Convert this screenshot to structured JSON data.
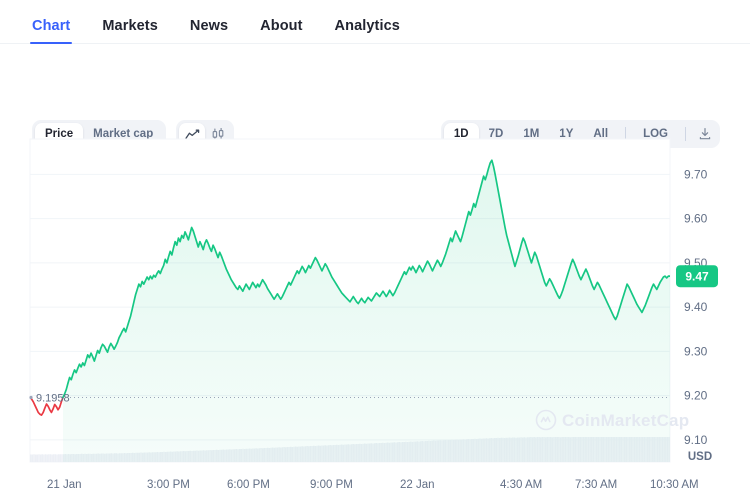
{
  "tabs": [
    {
      "label": "Chart",
      "active": true
    },
    {
      "label": "Markets",
      "active": false
    },
    {
      "label": "News",
      "active": false
    },
    {
      "label": "About",
      "active": false
    },
    {
      "label": "Analytics",
      "active": false
    }
  ],
  "toolbar": {
    "metric_toggle": [
      {
        "label": "Price",
        "active": true
      },
      {
        "label": "Market cap",
        "active": false
      }
    ],
    "chart_type_toggle": [
      {
        "icon": "line-chart-icon",
        "active": true
      },
      {
        "icon": "candlestick-chart-icon",
        "active": false
      }
    ],
    "ranges": [
      {
        "label": "1D",
        "active": true
      },
      {
        "label": "7D",
        "active": false
      },
      {
        "label": "1M",
        "active": false
      },
      {
        "label": "1Y",
        "active": false
      },
      {
        "label": "All",
        "active": false
      }
    ],
    "log_label": "LOG",
    "download_icon": "download-icon"
  },
  "chart_data": {
    "type": "line",
    "title": "",
    "xlabel": "",
    "ylabel": "USD",
    "currency_label": "USD",
    "ylim": [
      9.05,
      9.78
    ],
    "yticks": [
      9.7,
      9.6,
      9.5,
      9.4,
      9.3,
      9.2,
      9.1
    ],
    "ytick_labels": [
      "9.70",
      "9.60",
      "9.50",
      "9.40",
      "9.30",
      "9.20",
      "9.10"
    ],
    "xtick_labels": [
      "21 Jan",
      "3:00 PM",
      "6:00 PM",
      "9:00 PM",
      "22 Jan",
      "4:30 AM",
      "7:30 AM",
      "10:30 AM"
    ],
    "grid": true,
    "legend": "none",
    "current_price_badge": "9.47",
    "current_price": 9.47,
    "reference_line_value": 9.1958,
    "reference_line_label": "9.1958",
    "open_price": 9.1958,
    "high_price": 9.73,
    "low_price": 9.155,
    "line_color_up": "#16c784",
    "line_color_down": "#ea3943",
    "area_fill_color": "#e9f8f1",
    "badge_color": "#16c784",
    "watermark": "CoinMarketCap",
    "watermark_icon": "coinmarketcap-logo-icon",
    "series": [
      {
        "name": "Price",
        "values": [
          9.196,
          9.192,
          9.186,
          9.178,
          9.17,
          9.162,
          9.158,
          9.156,
          9.162,
          9.172,
          9.181,
          9.176,
          9.168,
          9.162,
          9.17,
          9.18,
          9.175,
          9.168,
          9.174,
          9.186,
          9.196,
          9.204,
          9.214,
          9.228,
          9.241,
          9.236,
          9.248,
          9.258,
          9.252,
          9.262,
          9.271,
          9.265,
          9.274,
          9.268,
          9.28,
          9.292,
          9.286,
          9.296,
          9.288,
          9.278,
          9.29,
          9.302,
          9.296,
          9.308,
          9.316,
          9.312,
          9.305,
          9.298,
          9.31,
          9.318,
          9.312,
          9.305,
          9.312,
          9.32,
          9.331,
          9.338,
          9.346,
          9.352,
          9.344,
          9.356,
          9.368,
          9.38,
          9.396,
          9.412,
          9.428,
          9.44,
          9.452,
          9.446,
          9.458,
          9.452,
          9.46,
          9.468,
          9.462,
          9.47,
          9.464,
          9.472,
          9.468,
          9.476,
          9.482,
          9.476,
          9.486,
          9.494,
          9.508,
          9.5,
          9.514,
          9.526,
          9.518,
          9.534,
          9.548,
          9.54,
          9.556,
          9.548,
          9.562,
          9.556,
          9.57,
          9.562,
          9.552,
          9.566,
          9.58,
          9.572,
          9.56,
          9.548,
          9.536,
          9.548,
          9.54,
          9.53,
          9.544,
          9.552,
          9.544,
          9.534,
          9.526,
          9.54,
          9.532,
          9.522,
          9.512,
          9.524,
          9.516,
          9.506,
          9.496,
          9.486,
          9.478,
          9.47,
          9.462,
          9.456,
          9.45,
          9.444,
          9.44,
          9.448,
          9.442,
          9.436,
          9.444,
          9.452,
          9.446,
          9.44,
          9.448,
          9.456,
          9.45,
          9.444,
          9.452,
          9.446,
          9.454,
          9.462,
          9.456,
          9.45,
          9.442,
          9.436,
          9.43,
          9.424,
          9.418,
          9.424,
          9.43,
          9.424,
          9.418,
          9.424,
          9.432,
          9.44,
          9.448,
          9.456,
          9.45,
          9.458,
          9.466,
          9.474,
          9.482,
          9.476,
          9.484,
          9.492,
          9.486,
          9.478,
          9.486,
          9.494,
          9.488,
          9.496,
          9.504,
          9.512,
          9.506,
          9.498,
          9.49,
          9.482,
          9.49,
          9.498,
          9.492,
          9.484,
          9.476,
          9.468,
          9.462,
          9.456,
          9.45,
          9.444,
          9.438,
          9.432,
          9.428,
          9.424,
          9.42,
          9.416,
          9.412,
          9.418,
          9.424,
          9.418,
          9.412,
          9.408,
          9.414,
          9.42,
          9.414,
          9.41,
          9.416,
          9.422,
          9.418,
          9.414,
          9.42,
          9.426,
          9.432,
          9.428,
          9.424,
          9.43,
          9.436,
          9.43,
          9.424,
          9.43,
          9.438,
          9.432,
          9.426,
          9.432,
          9.44,
          9.448,
          9.456,
          9.464,
          9.472,
          9.48,
          9.474,
          9.482,
          9.49,
          9.484,
          9.492,
          9.486,
          9.478,
          9.486,
          9.494,
          9.488,
          9.48,
          9.488,
          9.496,
          9.504,
          9.498,
          9.49,
          9.482,
          9.49,
          9.498,
          9.506,
          9.5,
          9.492,
          9.5,
          9.51,
          9.52,
          9.532,
          9.544,
          9.556,
          9.548,
          9.56,
          9.572,
          9.564,
          9.556,
          9.548,
          9.56,
          9.574,
          9.588,
          9.602,
          9.616,
          9.608,
          9.62,
          9.634,
          9.626,
          9.64,
          9.654,
          9.668,
          9.682,
          9.696,
          9.688,
          9.7,
          9.714,
          9.726,
          9.732,
          9.718,
          9.7,
          9.68,
          9.66,
          9.64,
          9.62,
          9.6,
          9.58,
          9.562,
          9.548,
          9.534,
          9.52,
          9.506,
          9.492,
          9.504,
          9.516,
          9.53,
          9.544,
          9.556,
          9.548,
          9.536,
          9.524,
          9.512,
          9.5,
          9.512,
          9.524,
          9.516,
          9.504,
          9.492,
          9.48,
          9.468,
          9.456,
          9.448,
          9.456,
          9.464,
          9.458,
          9.45,
          9.442,
          9.434,
          9.426,
          9.42,
          9.428,
          9.438,
          9.45,
          9.462,
          9.474,
          9.486,
          9.498,
          9.508,
          9.5,
          9.49,
          9.48,
          9.47,
          9.462,
          9.47,
          9.478,
          9.486,
          9.478,
          9.468,
          9.458,
          9.448,
          9.44,
          9.448,
          9.456,
          9.45,
          9.442,
          9.434,
          9.426,
          9.418,
          9.41,
          9.402,
          9.394,
          9.386,
          9.378,
          9.372,
          9.38,
          9.392,
          9.404,
          9.416,
          9.428,
          9.44,
          9.452,
          9.446,
          9.438,
          9.43,
          9.422,
          9.414,
          9.406,
          9.4,
          9.394,
          9.388,
          9.396,
          9.404,
          9.414,
          9.424,
          9.434,
          9.444,
          9.452,
          9.446,
          9.44,
          9.448,
          9.456,
          9.462,
          9.468,
          9.47,
          9.466,
          9.47,
          9.47
        ]
      }
    ],
    "volume_series": {
      "name": "Volume",
      "values": [
        0.3,
        0.3,
        0.31,
        0.3,
        0.3,
        0.31,
        0.3,
        0.31,
        0.3,
        0.31,
        0.3,
        0.31,
        0.31,
        0.3,
        0.31,
        0.31,
        0.3,
        0.31,
        0.31,
        0.31,
        0.31,
        0.32,
        0.31,
        0.32,
        0.31,
        0.32,
        0.32,
        0.31,
        0.32,
        0.32,
        0.32,
        0.33,
        0.32,
        0.33,
        0.32,
        0.33,
        0.33,
        0.32,
        0.33,
        0.33,
        0.33,
        0.34,
        0.33,
        0.34,
        0.34,
        0.33,
        0.34,
        0.34,
        0.34,
        0.35,
        0.34,
        0.35,
        0.35,
        0.34,
        0.35,
        0.35,
        0.35,
        0.36,
        0.35,
        0.36,
        0.36,
        0.36,
        0.37,
        0.36,
        0.37,
        0.37,
        0.37,
        0.38,
        0.37,
        0.38,
        0.38,
        0.38,
        0.39,
        0.38,
        0.39,
        0.39,
        0.39,
        0.4,
        0.39,
        0.4,
        0.4,
        0.41,
        0.4,
        0.41,
        0.41,
        0.42,
        0.41,
        0.42,
        0.42,
        0.43,
        0.42,
        0.43,
        0.43,
        0.44,
        0.43,
        0.44,
        0.44,
        0.45,
        0.44,
        0.45,
        0.45,
        0.46,
        0.45,
        0.46,
        0.46,
        0.47,
        0.46,
        0.47,
        0.47,
        0.48,
        0.47,
        0.48,
        0.48,
        0.49,
        0.48,
        0.49,
        0.49,
        0.5,
        0.49,
        0.5,
        0.5,
        0.51,
        0.5,
        0.51,
        0.51,
        0.52,
        0.51,
        0.52,
        0.52,
        0.53,
        0.52,
        0.53,
        0.53,
        0.54,
        0.53,
        0.54,
        0.54,
        0.55,
        0.54,
        0.55,
        0.56,
        0.55,
        0.56,
        0.56,
        0.57,
        0.56,
        0.57,
        0.58,
        0.57,
        0.58,
        0.58,
        0.59,
        0.58,
        0.59,
        0.6,
        0.59,
        0.6,
        0.6,
        0.61,
        0.6,
        0.61,
        0.62,
        0.61,
        0.62,
        0.62,
        0.63,
        0.62,
        0.63,
        0.64,
        0.63,
        0.64,
        0.64,
        0.65,
        0.64,
        0.65,
        0.66,
        0.65,
        0.66,
        0.66,
        0.67,
        0.66,
        0.67,
        0.68,
        0.67,
        0.68,
        0.68,
        0.69,
        0.68,
        0.69,
        0.7,
        0.69,
        0.7,
        0.7,
        0.71,
        0.7,
        0.71,
        0.72,
        0.71,
        0.72,
        0.72,
        0.73,
        0.72,
        0.73,
        0.74,
        0.73,
        0.74,
        0.74,
        0.75,
        0.74,
        0.75,
        0.76,
        0.75,
        0.76,
        0.76,
        0.77,
        0.76,
        0.77,
        0.78,
        0.77,
        0.78,
        0.78,
        0.79,
        0.78,
        0.79,
        0.8,
        0.79,
        0.8,
        0.8,
        0.81,
        0.8,
        0.81,
        0.82,
        0.81,
        0.82,
        0.82,
        0.83,
        0.82,
        0.83,
        0.84,
        0.83,
        0.84,
        0.84,
        0.85,
        0.84,
        0.85,
        0.86,
        0.85,
        0.86,
        0.86,
        0.87,
        0.86,
        0.87,
        0.88,
        0.87,
        0.88,
        0.88,
        0.89,
        0.88,
        0.89,
        0.9,
        0.89,
        0.9,
        0.9,
        0.91,
        0.9,
        0.91,
        0.92,
        0.91,
        0.92,
        0.92,
        0.93,
        0.92,
        0.93,
        0.94,
        0.93,
        0.94,
        0.94,
        0.95,
        0.94,
        0.95,
        0.96,
        0.95,
        0.96,
        0.96,
        0.97,
        0.96,
        0.97,
        0.97,
        0.96,
        0.97,
        0.97,
        0.98,
        0.97,
        0.98,
        0.98,
        0.97,
        0.98,
        0.98,
        0.99,
        0.98,
        0.99,
        0.98,
        0.99,
        0.99,
        1.0,
        0.99,
        1.0,
        0.99,
        1.0,
        1.0,
        0.99,
        1.0,
        1.0,
        0.99,
        1.0,
        1.0,
        1.0,
        0.99,
        1.0,
        1.0,
        1.0,
        1.0,
        0.99,
        1.0,
        1.0,
        1.0,
        1.0,
        1.0,
        0.99,
        1.0,
        1.0,
        1.0,
        1.0,
        1.0,
        1.0,
        1.0,
        1.0,
        1.0,
        1.0,
        1.0,
        1.0,
        1.0,
        1.0,
        1.0,
        1.0,
        1.0,
        1.0,
        1.0,
        1.0,
        1.0,
        1.0,
        1.0,
        1.0,
        1.0,
        1.0,
        1.0,
        1.0,
        1.0,
        1.0,
        1.0,
        1.0,
        1.0,
        1.0,
        1.0,
        1.0,
        1.0,
        1.0,
        1.0,
        1.0,
        1.0,
        1.0,
        1.0,
        1.0,
        1.0,
        1.0,
        1.0,
        1.0,
        1.0,
        1.0,
        1.0,
        1.0,
        1.0,
        1.0,
        1.0,
        1.0,
        1.0,
        1.0,
        1.0,
        1.0
      ]
    }
  }
}
